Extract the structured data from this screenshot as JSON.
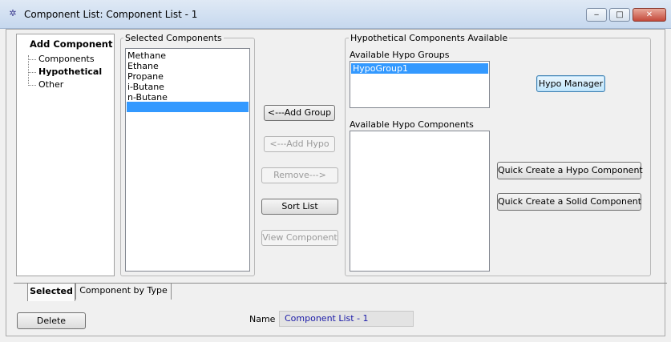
{
  "window": {
    "title": "Component List: Component List - 1",
    "app_icon": "hysys-app-icon",
    "controls": {
      "minimize": "‒",
      "maximize": "□",
      "close": "✕"
    }
  },
  "add_component": {
    "heading": "Add Component",
    "items": [
      {
        "label": "Components",
        "bold": false
      },
      {
        "label": "Hypothetical",
        "bold": true
      },
      {
        "label": "Other",
        "bold": false
      }
    ]
  },
  "selected_components": {
    "label": "Selected Components",
    "items": [
      "Methane",
      "Ethane",
      "Propane",
      "i-Butane",
      "n-Butane",
      ""
    ]
  },
  "actions": {
    "add_group": "<---Add Group",
    "add_hypo": "<---Add Hypo",
    "remove": "Remove--->",
    "sort_list": "Sort List",
    "view_component": "View Component"
  },
  "hypothetical": {
    "label": "Hypothetical Components Available",
    "groups_label": "Available Hypo Groups",
    "groups": [
      "HypoGroup1"
    ],
    "components_label": "Available Hypo Components",
    "components": [],
    "hypo_manager": "Hypo Manager",
    "quick_create_hypo": "Quick Create a Hypo Component",
    "quick_create_solid": "Quick Create a Solid Component"
  },
  "tabs": [
    {
      "label": "Selected",
      "active": true
    },
    {
      "label": "Component by Type",
      "active": false
    }
  ],
  "footer": {
    "delete": "Delete",
    "name_label": "Name",
    "name_value": "Component List - 1"
  },
  "colors": {
    "selection": "#3399ff",
    "name_text": "#1a1aa8"
  }
}
